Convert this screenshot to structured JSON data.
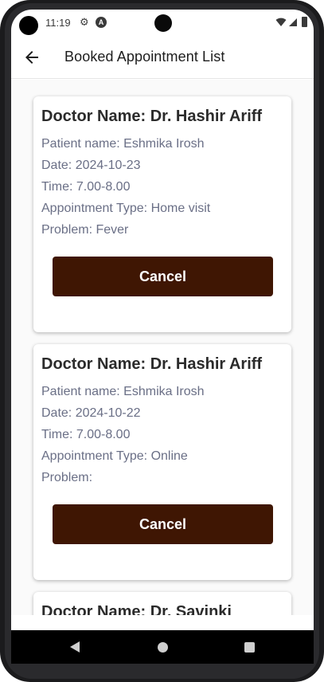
{
  "status_bar": {
    "time": "11:19",
    "icons": [
      "gear-icon",
      "a-badge-icon",
      "wifi-icon",
      "signal-icon",
      "battery-icon"
    ],
    "a_badge": "A"
  },
  "app_bar": {
    "title": "Booked Appointment List",
    "back_icon": "arrow-left-icon"
  },
  "appointments": [
    {
      "doctor": "Doctor Name: Dr. Hashir Ariff",
      "patient": "Patient name: Eshmika Irosh",
      "date": "Date: 2024-10-23",
      "time": "Time: 7.00-8.00",
      "type": "Appointment Type: Home visit",
      "problem": "Problem: Fever",
      "cancel_label": "Cancel"
    },
    {
      "doctor": "Doctor Name: Dr. Hashir Ariff",
      "patient": "Patient name: Eshmika Irosh",
      "date": "Date: 2024-10-22",
      "time": "Time: 7.00-8.00",
      "type": "Appointment Type: Online",
      "problem": "Problem:",
      "cancel_label": "Cancel"
    },
    {
      "doctor": "Doctor Name: Dr. Savinki"
    }
  ],
  "colors": {
    "cancel_button": "#3f1603",
    "detail_text": "#6a6f86",
    "heading_text": "#2b2b2b"
  },
  "nav_bar": {
    "icons": [
      "nav-back-icon",
      "nav-home-icon",
      "nav-recents-icon"
    ]
  }
}
